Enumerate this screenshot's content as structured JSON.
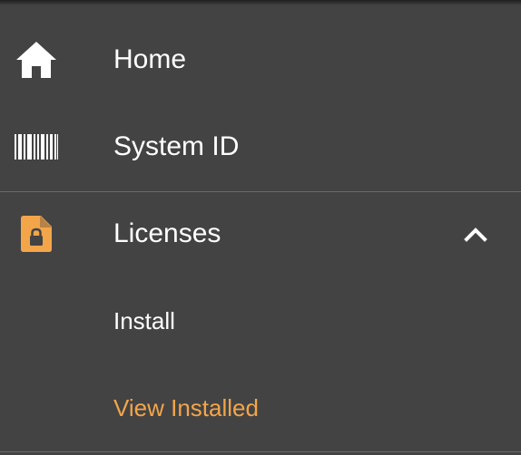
{
  "nav": {
    "items": [
      {
        "label": "Home",
        "icon": "home-icon"
      },
      {
        "label": "System ID",
        "icon": "barcode-icon"
      },
      {
        "label": "Licenses",
        "icon": "license-lock-icon",
        "expanded": true,
        "children": [
          {
            "label": "Install"
          },
          {
            "label": "View Installed",
            "active": true
          }
        ]
      }
    ]
  },
  "colors": {
    "background": "#434343",
    "text": "#ffffff",
    "accent": "#f3a54a",
    "divider": "#6a6a6a"
  }
}
